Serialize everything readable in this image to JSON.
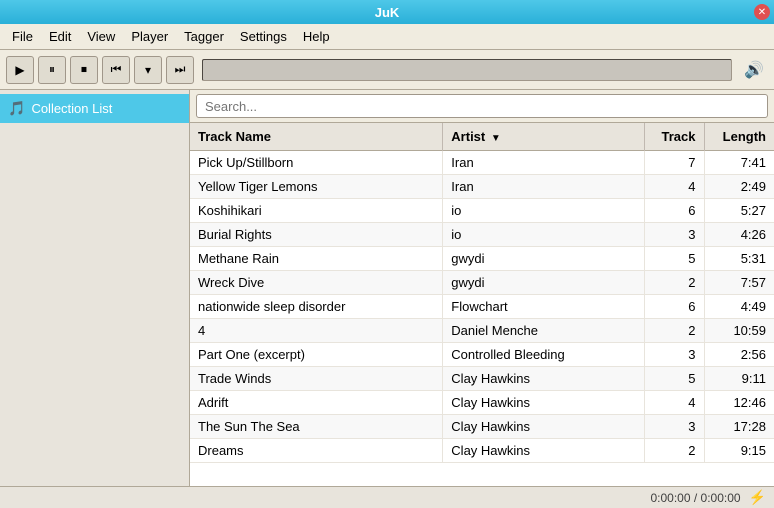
{
  "titleBar": {
    "title": "JuK"
  },
  "menu": {
    "items": [
      "File",
      "Edit",
      "View",
      "Player",
      "Tagger",
      "Settings",
      "Help"
    ]
  },
  "transport": {
    "playBtn": "▶",
    "pauseBtn": "⏸",
    "stopBtn": "⏹",
    "prevBtn": "⏮",
    "dropBtn": "▾",
    "nextBtn": "⏭",
    "volumeIcon": "🔊"
  },
  "sidebar": {
    "items": [
      {
        "icon": "🎵",
        "label": "Collection List",
        "active": true
      }
    ]
  },
  "search": {
    "placeholder": "Search..."
  },
  "table": {
    "columns": [
      {
        "id": "track-name",
        "label": "Track Name"
      },
      {
        "id": "artist",
        "label": "Artist",
        "sortable": true
      },
      {
        "id": "track",
        "label": "Track"
      },
      {
        "id": "length",
        "label": "Length"
      }
    ],
    "rows": [
      {
        "trackName": "Pick Up/Stillborn",
        "artist": "Iran",
        "track": "7",
        "length": "7:41"
      },
      {
        "trackName": "Yellow Tiger Lemons",
        "artist": "Iran",
        "track": "4",
        "length": "2:49"
      },
      {
        "trackName": "Koshihikari",
        "artist": "io",
        "track": "6",
        "length": "5:27"
      },
      {
        "trackName": "Burial Rights",
        "artist": "io",
        "track": "3",
        "length": "4:26"
      },
      {
        "trackName": "Methane Rain",
        "artist": "gwydi",
        "track": "5",
        "length": "5:31"
      },
      {
        "trackName": "Wreck Dive",
        "artist": "gwydi",
        "track": "2",
        "length": "7:57"
      },
      {
        "trackName": "nationwide sleep disorder",
        "artist": "Flowchart",
        "track": "6",
        "length": "4:49"
      },
      {
        "trackName": "4",
        "artist": "Daniel Menche",
        "track": "2",
        "length": "10:59"
      },
      {
        "trackName": "Part One (excerpt)",
        "artist": "Controlled Bleeding",
        "track": "3",
        "length": "2:56"
      },
      {
        "trackName": "Trade Winds",
        "artist": "Clay Hawkins",
        "track": "5",
        "length": "9:11"
      },
      {
        "trackName": "Adrift",
        "artist": "Clay Hawkins",
        "track": "4",
        "length": "12:46"
      },
      {
        "trackName": "The Sun The Sea",
        "artist": "Clay Hawkins",
        "track": "3",
        "length": "17:28"
      },
      {
        "trackName": "Dreams",
        "artist": "Clay Hawkins",
        "track": "2",
        "length": "9:15"
      }
    ]
  },
  "statusBar": {
    "timeDisplay": "0:00:00 / 0:00:00",
    "playlistIcon": "⚡"
  }
}
